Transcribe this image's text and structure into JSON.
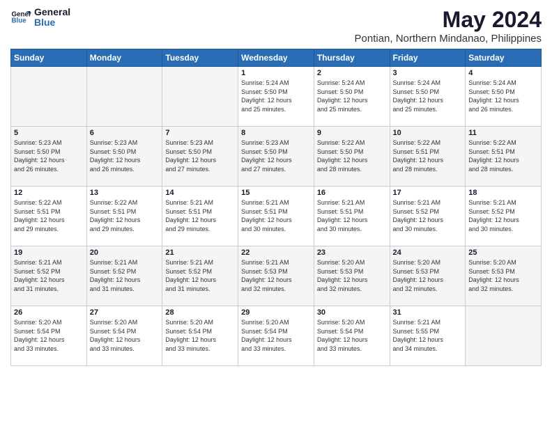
{
  "header": {
    "logo_line1": "General",
    "logo_line2": "Blue",
    "title": "May 2024",
    "subtitle": "Pontian, Northern Mindanao, Philippines"
  },
  "calendar": {
    "headers": [
      "Sunday",
      "Monday",
      "Tuesday",
      "Wednesday",
      "Thursday",
      "Friday",
      "Saturday"
    ],
    "weeks": [
      [
        {
          "day": "",
          "info": ""
        },
        {
          "day": "",
          "info": ""
        },
        {
          "day": "",
          "info": ""
        },
        {
          "day": "1",
          "info": "Sunrise: 5:24 AM\nSunset: 5:50 PM\nDaylight: 12 hours\nand 25 minutes."
        },
        {
          "day": "2",
          "info": "Sunrise: 5:24 AM\nSunset: 5:50 PM\nDaylight: 12 hours\nand 25 minutes."
        },
        {
          "day": "3",
          "info": "Sunrise: 5:24 AM\nSunset: 5:50 PM\nDaylight: 12 hours\nand 25 minutes."
        },
        {
          "day": "4",
          "info": "Sunrise: 5:24 AM\nSunset: 5:50 PM\nDaylight: 12 hours\nand 26 minutes."
        }
      ],
      [
        {
          "day": "5",
          "info": "Sunrise: 5:23 AM\nSunset: 5:50 PM\nDaylight: 12 hours\nand 26 minutes."
        },
        {
          "day": "6",
          "info": "Sunrise: 5:23 AM\nSunset: 5:50 PM\nDaylight: 12 hours\nand 26 minutes."
        },
        {
          "day": "7",
          "info": "Sunrise: 5:23 AM\nSunset: 5:50 PM\nDaylight: 12 hours\nand 27 minutes."
        },
        {
          "day": "8",
          "info": "Sunrise: 5:23 AM\nSunset: 5:50 PM\nDaylight: 12 hours\nand 27 minutes."
        },
        {
          "day": "9",
          "info": "Sunrise: 5:22 AM\nSunset: 5:50 PM\nDaylight: 12 hours\nand 28 minutes."
        },
        {
          "day": "10",
          "info": "Sunrise: 5:22 AM\nSunset: 5:51 PM\nDaylight: 12 hours\nand 28 minutes."
        },
        {
          "day": "11",
          "info": "Sunrise: 5:22 AM\nSunset: 5:51 PM\nDaylight: 12 hours\nand 28 minutes."
        }
      ],
      [
        {
          "day": "12",
          "info": "Sunrise: 5:22 AM\nSunset: 5:51 PM\nDaylight: 12 hours\nand 29 minutes."
        },
        {
          "day": "13",
          "info": "Sunrise: 5:22 AM\nSunset: 5:51 PM\nDaylight: 12 hours\nand 29 minutes."
        },
        {
          "day": "14",
          "info": "Sunrise: 5:21 AM\nSunset: 5:51 PM\nDaylight: 12 hours\nand 29 minutes."
        },
        {
          "day": "15",
          "info": "Sunrise: 5:21 AM\nSunset: 5:51 PM\nDaylight: 12 hours\nand 30 minutes."
        },
        {
          "day": "16",
          "info": "Sunrise: 5:21 AM\nSunset: 5:51 PM\nDaylight: 12 hours\nand 30 minutes."
        },
        {
          "day": "17",
          "info": "Sunrise: 5:21 AM\nSunset: 5:52 PM\nDaylight: 12 hours\nand 30 minutes."
        },
        {
          "day": "18",
          "info": "Sunrise: 5:21 AM\nSunset: 5:52 PM\nDaylight: 12 hours\nand 30 minutes."
        }
      ],
      [
        {
          "day": "19",
          "info": "Sunrise: 5:21 AM\nSunset: 5:52 PM\nDaylight: 12 hours\nand 31 minutes."
        },
        {
          "day": "20",
          "info": "Sunrise: 5:21 AM\nSunset: 5:52 PM\nDaylight: 12 hours\nand 31 minutes."
        },
        {
          "day": "21",
          "info": "Sunrise: 5:21 AM\nSunset: 5:52 PM\nDaylight: 12 hours\nand 31 minutes."
        },
        {
          "day": "22",
          "info": "Sunrise: 5:21 AM\nSunset: 5:53 PM\nDaylight: 12 hours\nand 32 minutes."
        },
        {
          "day": "23",
          "info": "Sunrise: 5:20 AM\nSunset: 5:53 PM\nDaylight: 12 hours\nand 32 minutes."
        },
        {
          "day": "24",
          "info": "Sunrise: 5:20 AM\nSunset: 5:53 PM\nDaylight: 12 hours\nand 32 minutes."
        },
        {
          "day": "25",
          "info": "Sunrise: 5:20 AM\nSunset: 5:53 PM\nDaylight: 12 hours\nand 32 minutes."
        }
      ],
      [
        {
          "day": "26",
          "info": "Sunrise: 5:20 AM\nSunset: 5:54 PM\nDaylight: 12 hours\nand 33 minutes."
        },
        {
          "day": "27",
          "info": "Sunrise: 5:20 AM\nSunset: 5:54 PM\nDaylight: 12 hours\nand 33 minutes."
        },
        {
          "day": "28",
          "info": "Sunrise: 5:20 AM\nSunset: 5:54 PM\nDaylight: 12 hours\nand 33 minutes."
        },
        {
          "day": "29",
          "info": "Sunrise: 5:20 AM\nSunset: 5:54 PM\nDaylight: 12 hours\nand 33 minutes."
        },
        {
          "day": "30",
          "info": "Sunrise: 5:20 AM\nSunset: 5:54 PM\nDaylight: 12 hours\nand 33 minutes."
        },
        {
          "day": "31",
          "info": "Sunrise: 5:21 AM\nSunset: 5:55 PM\nDaylight: 12 hours\nand 34 minutes."
        },
        {
          "day": "",
          "info": ""
        }
      ]
    ]
  }
}
